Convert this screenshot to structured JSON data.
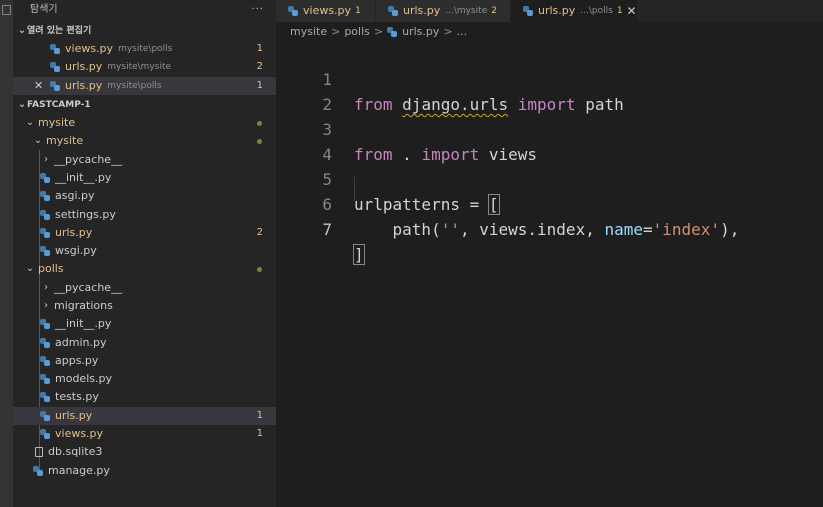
{
  "explorer": {
    "title": "탐색기",
    "more": "···",
    "open_editors": {
      "header": "열려 있는 편집기",
      "items": [
        {
          "name": "views.py",
          "path": "mysite\\polls",
          "badge": "1"
        },
        {
          "name": "urls.py",
          "path": "mysite\\mysite",
          "badge": "2"
        },
        {
          "name": "urls.py",
          "path": "mysite\\polls",
          "badge": "1"
        }
      ],
      "close_glyph": "✕"
    },
    "project": {
      "header": "FASTCAMP-1",
      "tree": {
        "mysite": "mysite",
        "mysite_inner": "mysite",
        "pycache1": "__pycache__",
        "init1": "__init__.py",
        "asgi": "asgi.py",
        "settings": "settings.py",
        "urls1": "urls.py",
        "urls1_badge": "2",
        "wsgi": "wsgi.py",
        "polls": "polls",
        "pycache2": "__pycache__",
        "migrations": "migrations",
        "init2": "__init__.py",
        "admin": "admin.py",
        "apps": "apps.py",
        "models": "models.py",
        "tests": "tests.py",
        "urls2": "urls.py",
        "urls2_badge": "1",
        "views": "views.py",
        "views_badge": "1",
        "db": "db.sqlite3",
        "manage": "manage.py"
      }
    }
  },
  "tabs": [
    {
      "name": "views.py",
      "desc": "",
      "badge": "1"
    },
    {
      "name": "urls.py",
      "desc": "...\\mysite",
      "badge": "2"
    },
    {
      "name": "urls.py",
      "desc": "...\\polls",
      "badge": "1",
      "close": "✕"
    }
  ],
  "breadcrumb": {
    "a": "mysite",
    "b": "polls",
    "c": "urls.py",
    "d": "...",
    "sep": ">"
  },
  "editor": {
    "line_numbers": [
      "1",
      "2",
      "3",
      "4",
      "5",
      "6",
      "7"
    ],
    "tokens": {
      "l1_from": "from",
      "l1_mod": "django.urls",
      "l1_import": "import",
      "l1_name": "path",
      "l3_from": "from",
      "l3_mod": ".",
      "l3_import": "import",
      "l3_name": "views",
      "l5_var": "urlpatterns",
      "l5_eq": "=",
      "l5_br": "[",
      "l6_path": "path(",
      "l6_str1": "''",
      "l6_mid": ", views.index, ",
      "l6_kw": "name",
      "l6_eq": "=",
      "l6_str2": "'index'",
      "l6_end": "),",
      "l7_br": "]"
    }
  },
  "colors": {
    "keyword": "#c586c0",
    "string": "#ce9178",
    "param": "#9cdcfe",
    "modified": "#e2c08d"
  }
}
